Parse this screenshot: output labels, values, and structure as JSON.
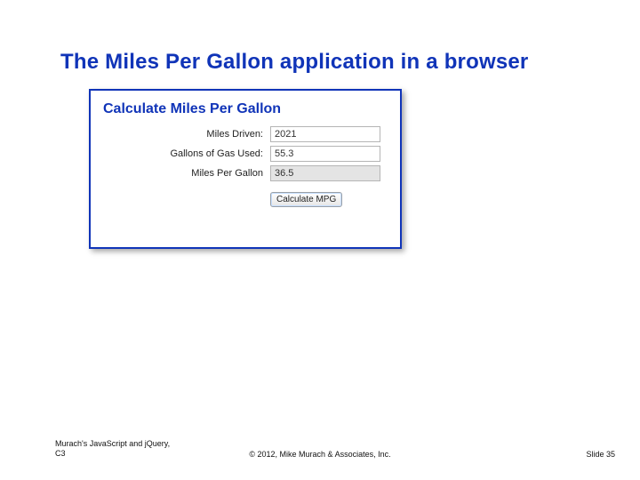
{
  "slide": {
    "title": "The Miles Per Gallon application in a browser"
  },
  "window": {
    "heading": "Calculate Miles Per Gallon",
    "fields": {
      "miles_driven": {
        "label": "Miles Driven:",
        "value": "2021"
      },
      "gallons_used": {
        "label": "Gallons of Gas Used:",
        "value": "55.3"
      },
      "mpg": {
        "label": "Miles Per Gallon",
        "value": "36.5"
      }
    },
    "button_label": "Calculate MPG"
  },
  "footer": {
    "left_line1": "Murach's JavaScript and jQuery,",
    "left_line2": "C3",
    "center": "© 2012, Mike Murach & Associates, Inc.",
    "right": "Slide 35"
  }
}
